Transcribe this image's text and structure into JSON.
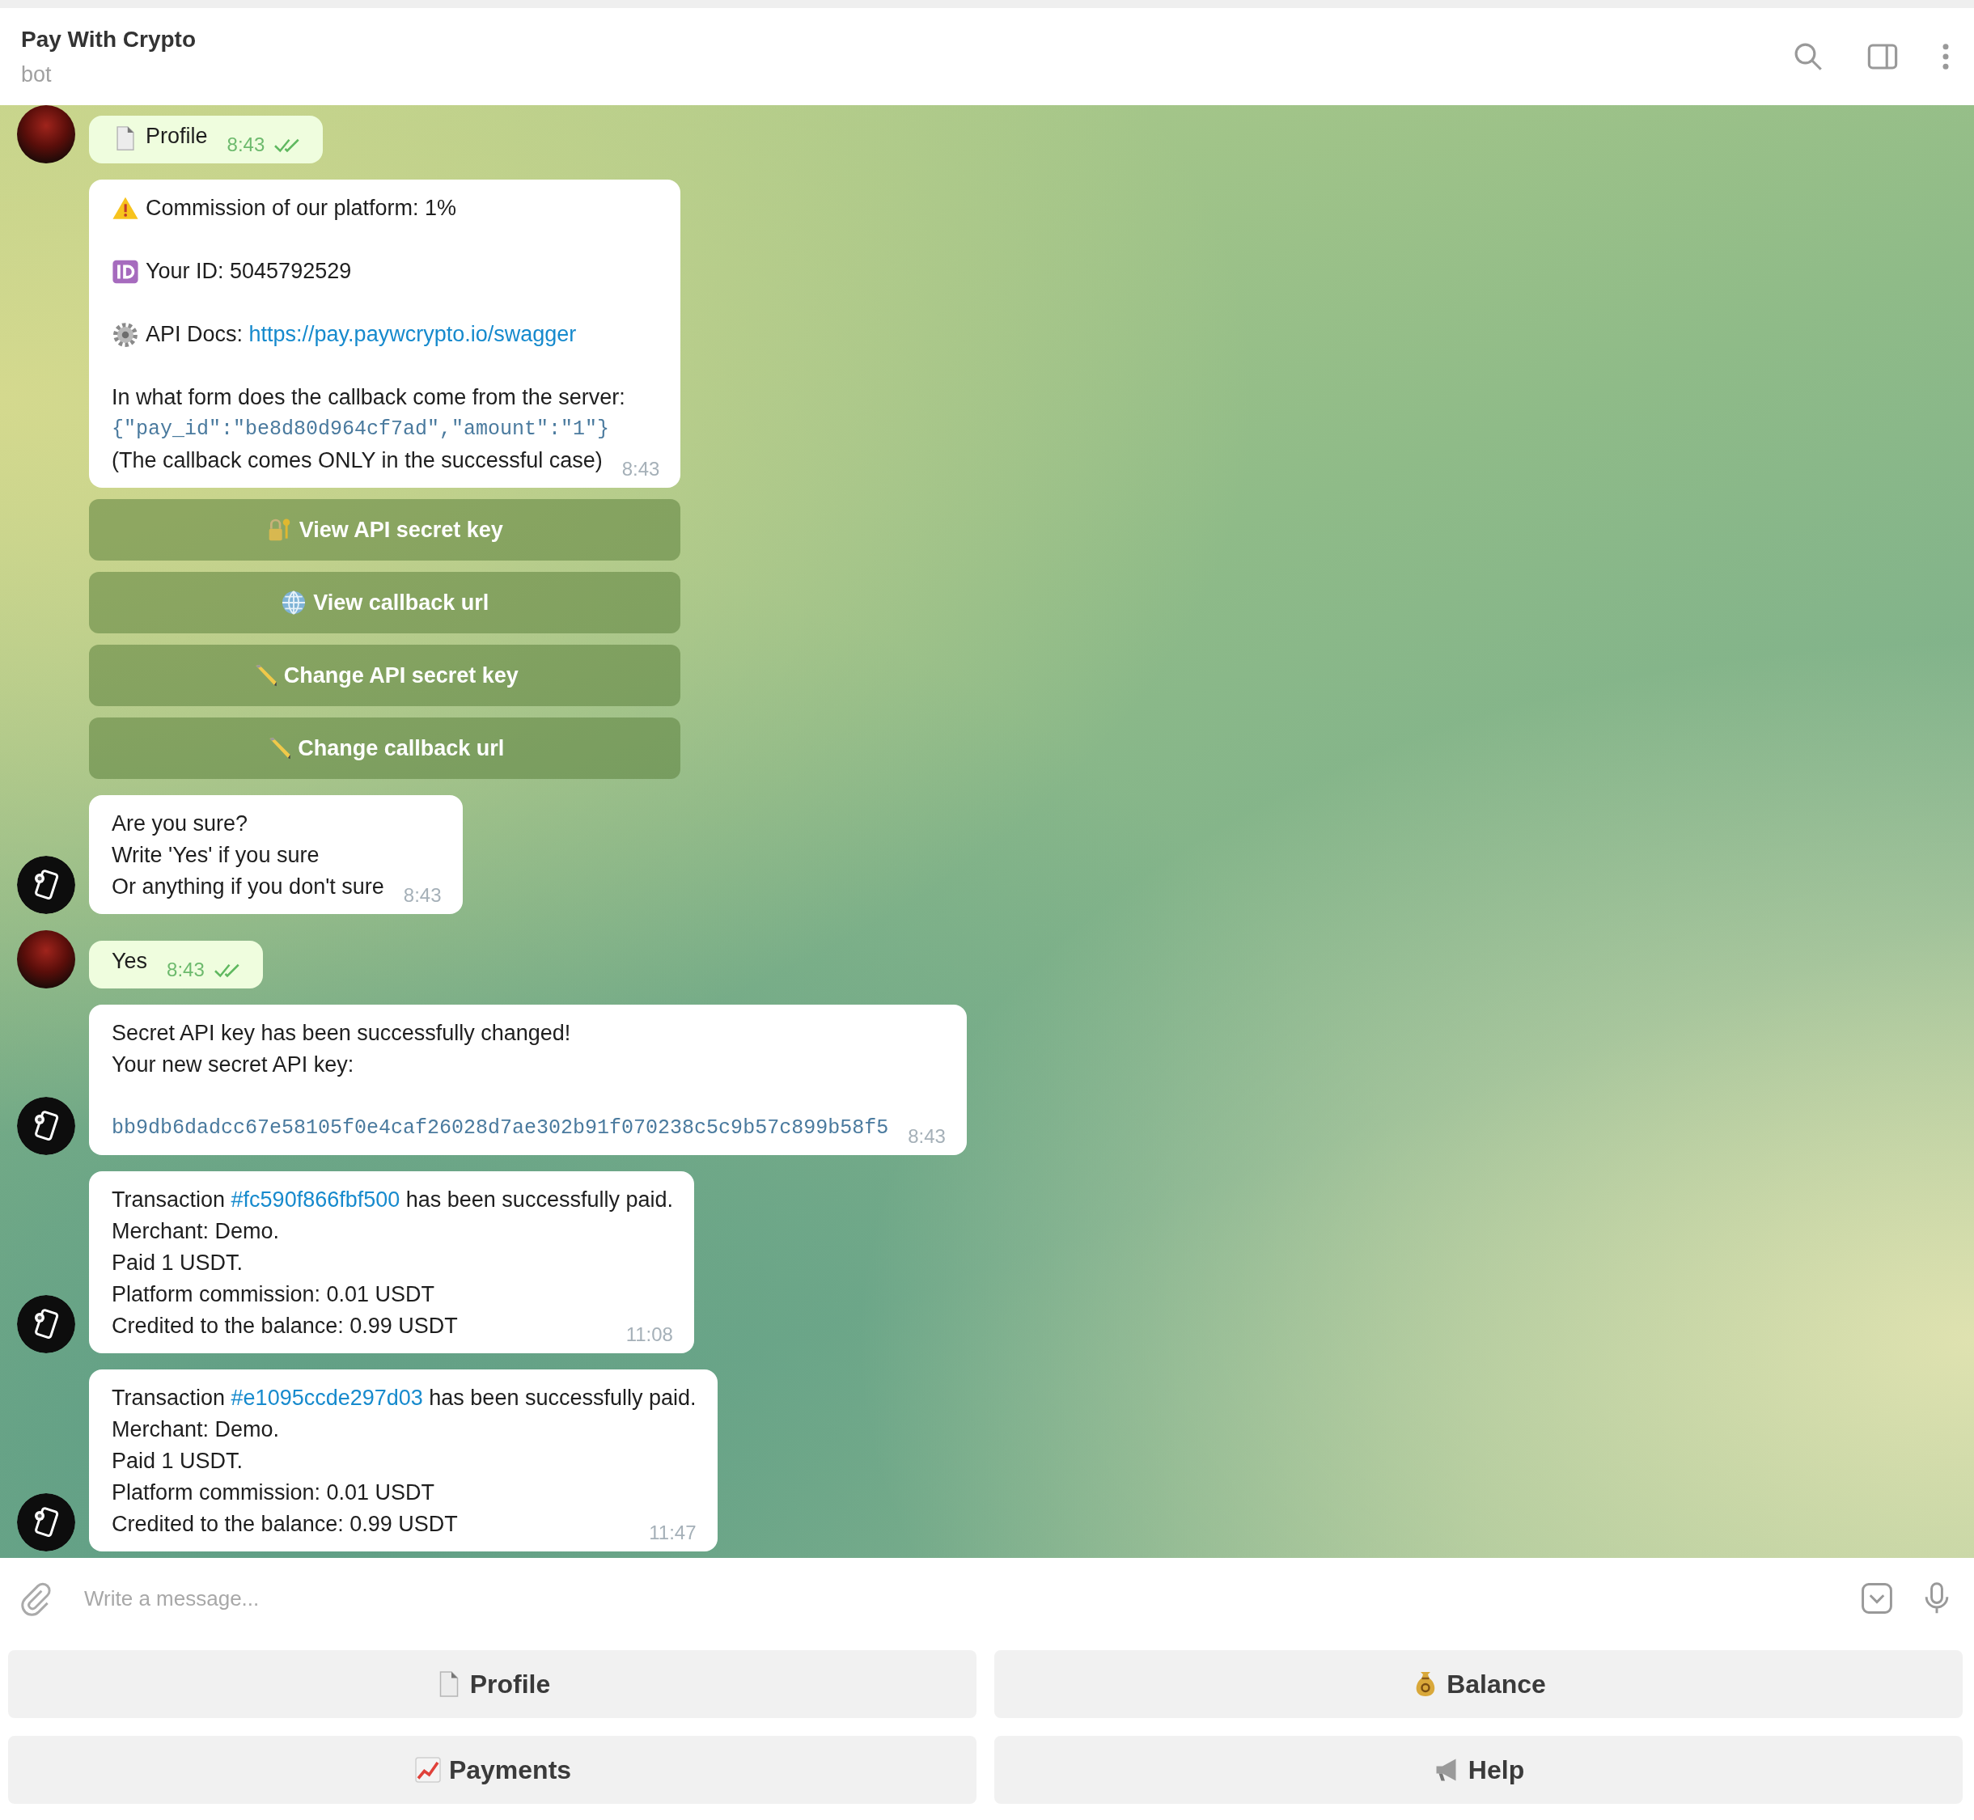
{
  "header": {
    "title": "Pay With Crypto",
    "subtitle": "bot"
  },
  "messages": [
    {
      "kind": "outgoing",
      "avatar": true,
      "time": "8:43",
      "read": true,
      "paragraphs": [
        [
          [
            {
              "text": "Profile",
              "kind": "plain"
            }
          ]
        ]
      ]
    },
    {
      "kind": "incoming",
      "avatar": false,
      "time": "8:43",
      "paragraphs": [
        [
          [
            {
              "text": "Commission of our platform: 1%",
              "kind": "plain"
            }
          ]
        ],
        [
          [
            {
              "text": "Your ID: 5045792529",
              "kind": "plain"
            }
          ]
        ],
        [
          [
            {
              "text": "API Docs: ",
              "kind": "plain"
            },
            {
              "text": "https://pay.paywcrypto.io/swagger",
              "kind": "link"
            }
          ]
        ],
        [
          [
            {
              "text": "In what form does the callback come from the server:",
              "kind": "plain"
            }
          ],
          [
            {
              "text": "{\"pay_id\":\"be8d80d964cf7ad\",\"amount\":\"1\"}",
              "kind": "code"
            }
          ],
          [
            {
              "text": "(The callback comes ONLY in the successful case)",
              "kind": "plain"
            }
          ]
        ]
      ],
      "buttons": [
        "View API secret key",
        "View callback url",
        "Change API secret key",
        "Change callback url"
      ]
    },
    {
      "kind": "incoming",
      "avatar": true,
      "time": "8:43",
      "paragraphs": [
        [
          [
            {
              "text": "Are you sure?",
              "kind": "plain"
            }
          ],
          [
            {
              "text": "Write 'Yes' if you sure",
              "kind": "plain"
            }
          ],
          [
            {
              "text": "Or anything if you don't sure",
              "kind": "plain"
            }
          ]
        ]
      ]
    },
    {
      "kind": "outgoing",
      "avatar": true,
      "time": "8:43",
      "read": true,
      "paragraphs": [
        [
          [
            {
              "text": "Yes",
              "kind": "plain"
            }
          ]
        ]
      ]
    },
    {
      "kind": "incoming",
      "avatar": true,
      "time": "8:43",
      "paragraphs": [
        [
          [
            {
              "text": "Secret API key has been successfully changed!",
              "kind": "plain"
            }
          ],
          [
            {
              "text": "Your new secret API key:",
              "kind": "plain"
            }
          ]
        ],
        [
          [
            {
              "text": "bb9db6dadcc67e58105f0e4caf26028d7ae302b91f070238c5c9b57c899b58f5",
              "kind": "code"
            }
          ]
        ]
      ]
    },
    {
      "kind": "incoming",
      "avatar": true,
      "time": "11:08",
      "paragraphs": [
        [
          [
            {
              "text": "Transaction ",
              "kind": "plain"
            },
            {
              "text": "#fc590f866fbf500",
              "kind": "link"
            },
            {
              "text": " has been successfully paid.",
              "kind": "plain"
            }
          ],
          [
            {
              "text": "Merchant: Demo.",
              "kind": "plain"
            }
          ],
          [
            {
              "text": "Paid 1 USDT.",
              "kind": "plain"
            }
          ],
          [
            {
              "text": "Platform commission: 0.01 USDT",
              "kind": "plain"
            }
          ],
          [
            {
              "text": "Credited to the balance: 0.99 USDT",
              "kind": "plain"
            }
          ]
        ]
      ]
    },
    {
      "kind": "incoming",
      "avatar": true,
      "time": "11:47",
      "paragraphs": [
        [
          [
            {
              "text": "Transaction ",
              "kind": "plain"
            },
            {
              "text": "#e1095ccde297d03",
              "kind": "link"
            },
            {
              "text": " has been successfully paid.",
              "kind": "plain"
            }
          ],
          [
            {
              "text": "Merchant: Demo.",
              "kind": "plain"
            }
          ],
          [
            {
              "text": "Paid 1 USDT.",
              "kind": "plain"
            }
          ],
          [
            {
              "text": "Platform commission: 0.01 USDT",
              "kind": "plain"
            }
          ],
          [
            {
              "text": "Credited to the balance: 0.99 USDT",
              "kind": "plain"
            }
          ]
        ]
      ]
    }
  ],
  "composer": {
    "placeholder": "Write a message..."
  },
  "keyboard": [
    "Profile",
    "Balance",
    "Payments",
    "Help"
  ]
}
